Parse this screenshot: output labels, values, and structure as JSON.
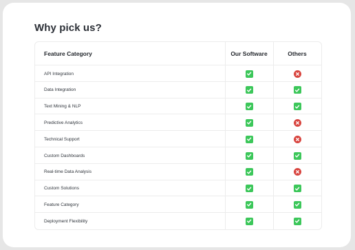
{
  "page": {
    "heading": "Why pick us?"
  },
  "table": {
    "headers": {
      "feature": "Feature Category",
      "ours": "Our Software",
      "others": "Others"
    },
    "rows": [
      {
        "feature": "API Integration",
        "ours": "check",
        "others": "cross"
      },
      {
        "feature": "Data Integration",
        "ours": "check",
        "others": "check"
      },
      {
        "feature": "Text Mining & NLP",
        "ours": "check",
        "others": "check"
      },
      {
        "feature": "Predictive Analytics",
        "ours": "check",
        "others": "cross"
      },
      {
        "feature": "Technical Support",
        "ours": "check",
        "others": "cross"
      },
      {
        "feature": "Custom Dashboards",
        "ours": "check",
        "others": "check"
      },
      {
        "feature": "Real-time Data Analysis",
        "ours": "check",
        "others": "cross"
      },
      {
        "feature": "Custom Solutions",
        "ours": "check",
        "others": "check"
      },
      {
        "feature": "Feature Category",
        "ours": "check",
        "others": "check"
      },
      {
        "feature": "Deployment Flexibility",
        "ours": "check",
        "others": "check"
      }
    ]
  },
  "colors": {
    "check": "#3cc75a",
    "cross": "#d8453f",
    "text": "#2b2f36"
  },
  "icons": {
    "check": "check-icon",
    "cross": "cross-icon"
  }
}
